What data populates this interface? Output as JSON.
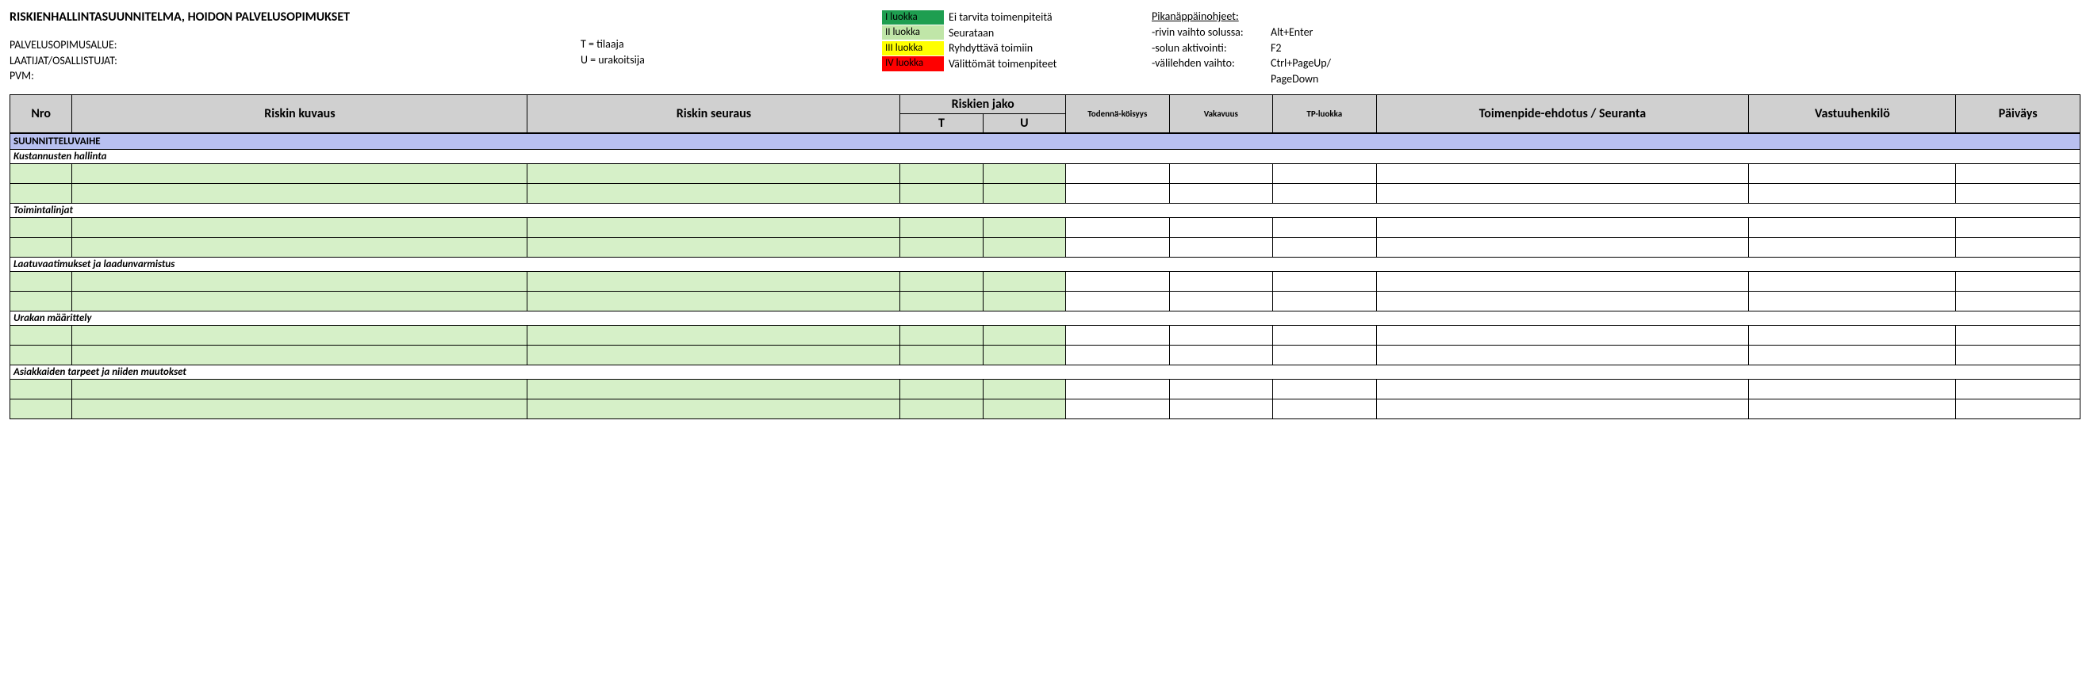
{
  "header": {
    "title": "RISKIENHALLINTASUUNNITELMA, HOIDON PALVELUSOPIMUKSET",
    "meta": {
      "area_label": "PALVELUSOPIMUSALUE:",
      "authors_label": "LAATIJAT/OSALLISTUJAT:",
      "date_label": "PVM:"
    },
    "tu_legend": {
      "t": "T = tilaaja",
      "u": "U = urakoitsija"
    },
    "classes": [
      {
        "swatch": "I luokka",
        "desc": "Ei tarvita toimenpiteitä"
      },
      {
        "swatch": "II luokka",
        "desc": "Seurataan"
      },
      {
        "swatch": "III luokka",
        "desc": "Ryhdyttävä toimiin"
      },
      {
        "swatch": "IV luokka",
        "desc": "Välittömät toimenpiteet"
      }
    ],
    "hints": {
      "title": "Pikanäppäinohjeet:",
      "rows": [
        {
          "label": "-rivin vaihto solussa:",
          "key": "Alt+Enter"
        },
        {
          "label": "-solun aktivointi:",
          "key": "F2"
        },
        {
          "label": "-välilehden vaihto:",
          "key": "Ctrl+PageUp/"
        },
        {
          "label": "",
          "key": "PageDown"
        }
      ]
    }
  },
  "table": {
    "columns": {
      "nro": "Nro",
      "kuvaus": "Riskin kuvaus",
      "seuraus": "Riskin seuraus",
      "jako": "Riskien jako",
      "t": "T",
      "u": "U",
      "todnak": "Todennä-köisyys",
      "vakavuus": "Vakavuus",
      "tpluokka": "TP-luokka",
      "toimenpide": "Toimenpide-ehdotus / Seuranta",
      "vastuu": "Vastuuhenkilö",
      "paivays": "Päiväys"
    },
    "phase": "SUUNNITTELUVAIHE",
    "sections": [
      "Kustannusten hallinta",
      "Toimintalinjat",
      "Laatuvaatimukset ja laadunvarmistus",
      "Urakan määrittely",
      "Asiakkaiden tarpeet ja niiden  muutokset"
    ]
  }
}
